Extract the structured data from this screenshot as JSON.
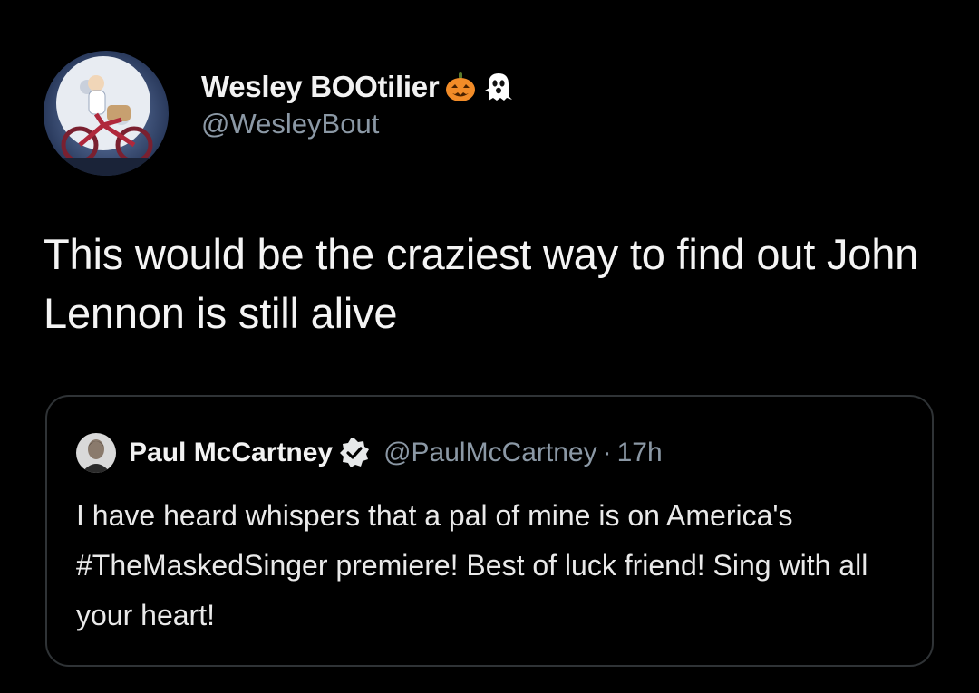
{
  "tweet": {
    "author": {
      "display_name": "Wesley BOOtilier",
      "handle": "@WesleyBout",
      "avatar_icon": "moon-bicycle-avatar",
      "name_emojis": [
        "jack-o-lantern-icon",
        "ghost-icon"
      ]
    },
    "text": "This would be the craziest way to find out John Lennon is still alive"
  },
  "quoted_tweet": {
    "author": {
      "display_name": "Paul McCartney",
      "handle": "@PaulMcCartney",
      "avatar_icon": "portrait-avatar",
      "verified_icon": "verified-badge-icon"
    },
    "separator": "·",
    "time": "17h",
    "text": "I have heard whispers that a pal of mine is on America's #TheMaskedSinger premiere! Best of luck friend! Sing with all your heart!"
  },
  "colors": {
    "background": "#000000",
    "primary_text": "#e7e9ea",
    "secondary_text": "#8b98a5",
    "border": "#2f3336",
    "pumpkin": "#f28c28"
  }
}
